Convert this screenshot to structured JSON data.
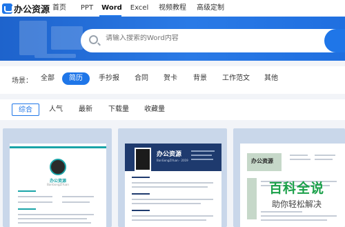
{
  "brand": {
    "name": "办公资源"
  },
  "nav": {
    "items": [
      {
        "label": "首页",
        "active": false
      },
      {
        "label": "PPT",
        "active": false
      },
      {
        "label": "Word",
        "active": true
      },
      {
        "label": "Excel",
        "active": false
      },
      {
        "label": "视频教程",
        "active": false
      },
      {
        "label": "高级定制",
        "active": false
      }
    ]
  },
  "search": {
    "placeholder": "请输入搜索的Word内容",
    "accent": "#1f76e8"
  },
  "scene": {
    "label": "场景：",
    "items": [
      {
        "label": "全部",
        "active": false
      },
      {
        "label": "简历",
        "active": true
      },
      {
        "label": "手抄报",
        "active": false
      },
      {
        "label": "合同",
        "active": false
      },
      {
        "label": "贺卡",
        "active": false
      },
      {
        "label": "背景",
        "active": false
      },
      {
        "label": "工作范文",
        "active": false
      },
      {
        "label": "其他",
        "active": false
      }
    ]
  },
  "sort": {
    "items": [
      {
        "label": "综合",
        "active": true
      },
      {
        "label": "人气",
        "active": false
      },
      {
        "label": "最新",
        "active": false
      },
      {
        "label": "下载量",
        "active": false
      },
      {
        "label": "收藏量",
        "active": false
      }
    ]
  },
  "cards": [
    {
      "header": "办公资源",
      "subheader": "BanGongZiYuan"
    },
    {
      "header": "办公资源",
      "subheader": "BanGongZiYuan · 2019"
    },
    {
      "header": "办公资源",
      "subheader": ""
    }
  ],
  "watermark": {
    "big": "百科全说",
    "small": "助你轻松解决"
  },
  "colors": {
    "accent": "#1f76e8",
    "banner": "#2a7ae6",
    "teal": "#19a4a8",
    "navy": "#1e3a6e",
    "green": "#1aa049"
  }
}
